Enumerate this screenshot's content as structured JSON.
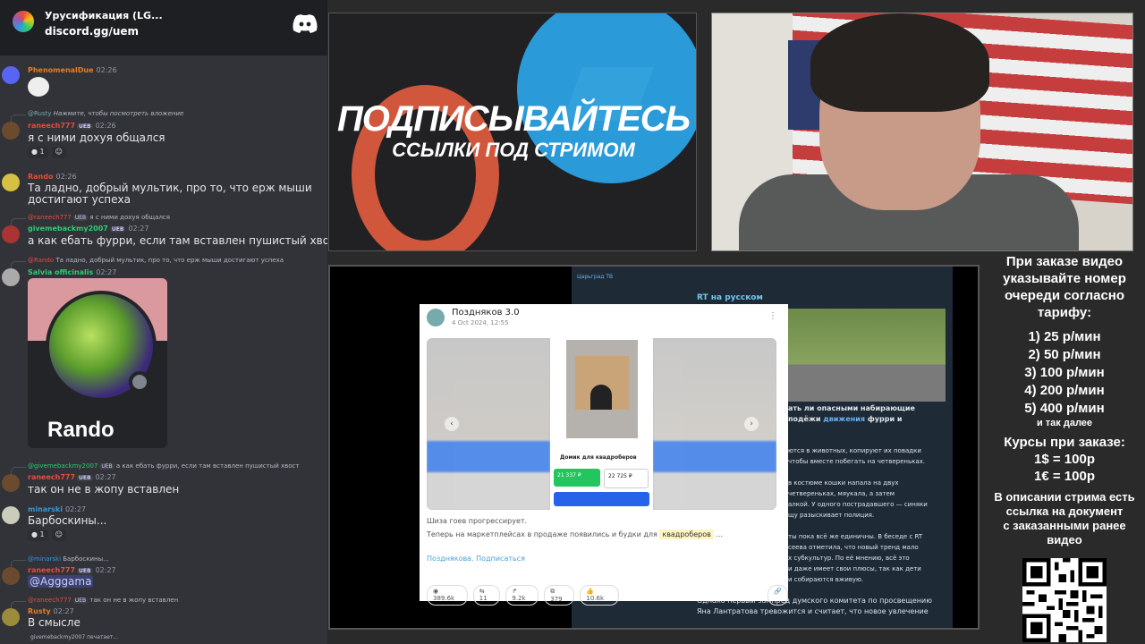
{
  "chat": {
    "server_name": "Урусификация (LG...",
    "server_link": "discord.gg/uem",
    "messages": [
      {
        "user": "PhenomenalDue",
        "time": "02:26"
      },
      {
        "reply_user": "@Rusty",
        "reply_text": "Нажмите, чтобы посмотреть вложение",
        "user": "raneech777",
        "badge": "UEB",
        "time": "02:26",
        "text": "я с ними дохуя общался",
        "react1": "1"
      },
      {
        "user": "Rando",
        "time": "02:26",
        "text1": "Та ладно, добрый мультик, про то, что ерж мыши",
        "text2": "достигают успеха"
      },
      {
        "reply_user": "@raneech777",
        "reply_badge": "UEB",
        "reply_text": "я с ними дохуя общался",
        "user": "givemebackmy2007",
        "badge": "UEB",
        "time": "02:27",
        "text": "а как ебать фурри, если там вставлен пушистый хвост"
      },
      {
        "reply_user": "@Rando",
        "reply_text": "Та ладно, добрый мультик, про то, что ерж мыши достигают успеха",
        "user": "Salvia officinalis",
        "time": "02:27",
        "card_name": "Rando"
      },
      {
        "reply_user": "@givemebackmy2007",
        "reply_badge": "UEB",
        "reply_text": "а как ебать фурри, если там вставлен пушистый хвост",
        "user": "raneech777",
        "badge": "UEB",
        "time": "02:27",
        "text": "так он не в жопу вставлен"
      },
      {
        "user": "minarski",
        "time": "02:27",
        "text": "Барбоскины...",
        "react1": "1"
      },
      {
        "reply_user": "@minarski",
        "reply_text": "Барбоскины...",
        "user": "raneech777",
        "badge": "UEB",
        "time": "02:27",
        "text": "@Agggama"
      },
      {
        "reply_user": "@raneech777",
        "reply_badge": "UEB",
        "reply_text": "так он не в жопу вставлен",
        "user": "Rusty",
        "time": "02:27",
        "text": "В смысле"
      }
    ],
    "typing": "givemebackmy2007 печатает..."
  },
  "promo": {
    "title": "ПОДПИСЫВАЙТЕСЬ",
    "subtitle": "ССЫЛКИ ПОД СТРИМОМ"
  },
  "post": {
    "channel": "Поздняков 3.0",
    "date": "4 Oct 2024, 12:55",
    "product_title": "Домик для квадроберов",
    "price_green": "21 337 ₽",
    "price_old": "22 725 ₽",
    "line1": "Шиза гоев прогрессирует.",
    "line2": "Теперь на маркетплейсах в продаже появились и будки для",
    "tag": "квадроберов",
    "line2_end": "...",
    "link": "Позднякова. Подписаться",
    "views": "389.6k",
    "comments": "11",
    "shares": "9.2k",
    "reposts": "379",
    "likes": "10.6k"
  },
  "tg": {
    "channel": "Царьград ТВ",
    "source": "RT на русском",
    "head1": "ать ли опасными набирающие",
    "head2a": "подёжи ",
    "head2link": "движения",
    "head2b": " фурри и",
    "body": [
      "ются в животных, копируют их повадки",
      "чтобы вместе побегать на четвереньках.",
      "",
      "в костюме кошки напала на двух",
      "четвереньках, мяукала, а затем",
      "алкой. У одного пострадавшего — синяки",
      "щу разыскивает полиция.",
      "",
      "ты пока всё же единичны. В беседе с RT",
      "сеева отметила, что новый тренд мало",
      "х субкультур. По её мнению, всё это",
      "и даже имеет свои плюсы, так как дети",
      "и собираются вживую."
    ],
    "bottom1": "Однако первый зампред думского комитета по просвещению",
    "bottom2": "Яна Лантратова тревожится и считает, что новое увлечение"
  },
  "side": {
    "intro": [
      "При заказе видео",
      "указывайте номер",
      "очереди согласно",
      "тарифу:"
    ],
    "tariffs": [
      "1) 25 р/мин",
      "2) 50 р/мин",
      "3) 100 р/мин",
      "4) 200 р/мин",
      "5) 400 р/мин"
    ],
    "etc": "и так далее",
    "courses": [
      "Курсы при заказе:",
      "1$ = 100р",
      "1€ = 100р"
    ],
    "desc": [
      "В описании стрима есть",
      "ссылка на документ",
      "с заказанными ранее",
      "видео"
    ]
  },
  "colors": {
    "discord_bg": "#313338",
    "accent": "#5865f2",
    "tg_link": "#6ab2f2"
  }
}
